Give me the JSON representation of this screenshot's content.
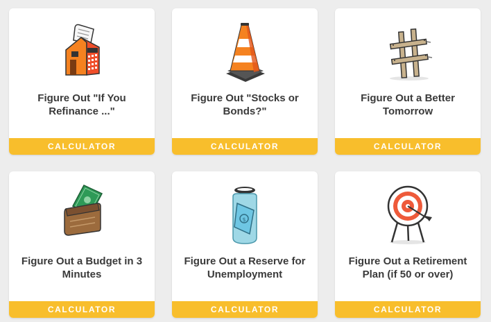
{
  "cards": [
    {
      "title": "Figure Out \"If You Refinance ...\"",
      "cta": "CALCULATOR",
      "icon": "calculator-house-icon"
    },
    {
      "title": "Figure Out \"Stocks or Bonds?\"",
      "cta": "CALCULATOR",
      "icon": "traffic-cone-icon"
    },
    {
      "title": "Figure Out a Better Tomorrow",
      "cta": "CALCULATOR",
      "icon": "wooden-fence-icon"
    },
    {
      "title": "Figure Out a Budget in 3 Minutes",
      "cta": "CALCULATOR",
      "icon": "wallet-cash-icon"
    },
    {
      "title": "Figure Out a Reserve for Unemployment",
      "cta": "CALCULATOR",
      "icon": "money-jar-icon"
    },
    {
      "title": "Figure Out a Retirement Plan (if 50 or over)",
      "cta": "CALCULATOR",
      "icon": "target-arrow-icon"
    }
  ],
  "colors": {
    "accent": "#f8be2c",
    "background": "#ededed",
    "card": "#ffffff",
    "text": "#3a3a3a"
  }
}
